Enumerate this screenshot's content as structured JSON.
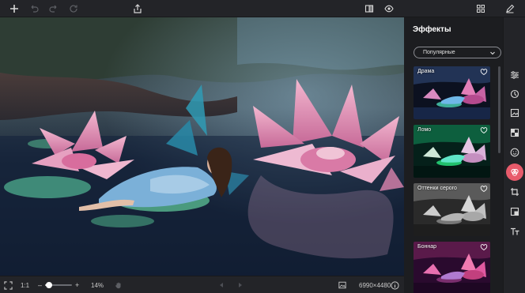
{
  "toolbar": {
    "icons": [
      "plus-icon",
      "undo-icon",
      "redo-icon",
      "reset-icon",
      "share-icon",
      "compare-icon",
      "preview-eye-icon",
      "grid-icon",
      "edit-pencil-icon"
    ]
  },
  "bottom": {
    "zoom_ratio": "1:1",
    "zoom_minus": "–",
    "zoom_plus": "+",
    "zoom_percent": "14%",
    "zoom_level": 0.14,
    "image_size": "6990×4480"
  },
  "effects": {
    "title": "Эффекты",
    "filter_selected": "Популярные",
    "cards": [
      {
        "label": "Драма"
      },
      {
        "label": "Ломо"
      },
      {
        "label": "Оттенки серого"
      },
      {
        "label": "Боннар"
      }
    ]
  },
  "right_tools": [
    "adjust-sliders-icon",
    "retouch-icon",
    "image-icon",
    "checker-icon",
    "smiley-icon",
    "effects-icon",
    "crop-icon",
    "resize-icon",
    "text-icon"
  ],
  "colors": {
    "accent": "#e85b6b",
    "panel_bg": "#1c1d20",
    "toolbar_bg": "#232428"
  }
}
